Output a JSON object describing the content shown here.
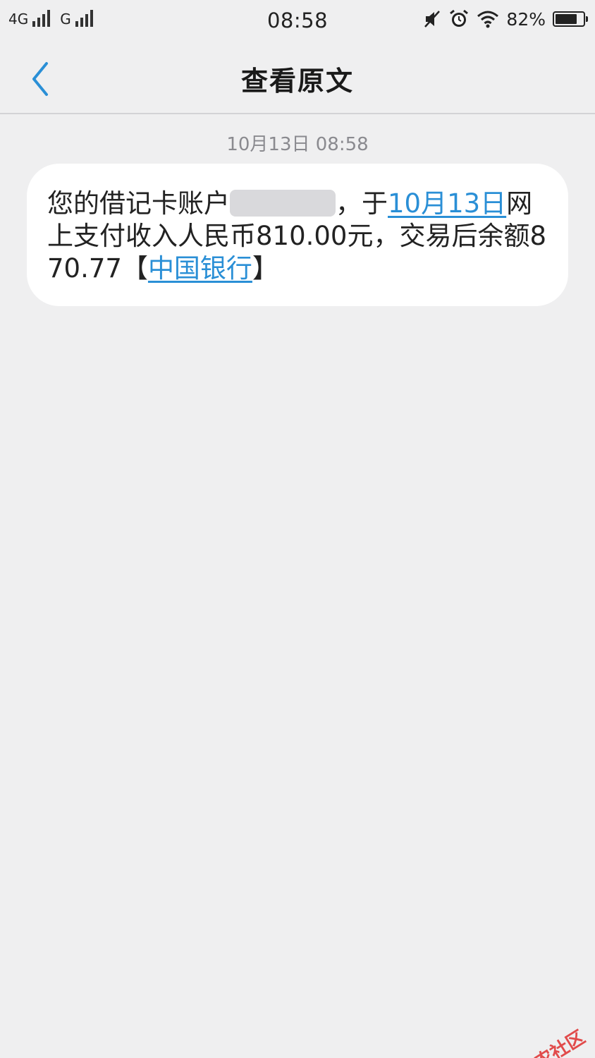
{
  "status_bar": {
    "network1": "4G",
    "network2": "G",
    "time": "08:58",
    "battery": "82%",
    "battery_level": 0.82,
    "icons": [
      "mute-icon",
      "alarm-icon",
      "wifi-icon",
      "battery-icon"
    ]
  },
  "header": {
    "title": "查看原文",
    "back_icon": "chevron-left-icon"
  },
  "message": {
    "timestamp": "10月13日 08:58",
    "text_part1": "您的借记卡账户",
    "text_part2": "，于",
    "date_link": "10月13日",
    "text_part3": "网上支付收入人民币810.00元，交易后余额870.77【",
    "bank_link": "中国银行",
    "text_part4": "】"
  },
  "watermark": {
    "text": "卡农社区"
  },
  "colors": {
    "background": "#efeff0",
    "bubble": "#ffffff",
    "link": "#2a8fd6",
    "back_icon": "#2a8fd6",
    "timestamp": "#8a8a8f"
  }
}
